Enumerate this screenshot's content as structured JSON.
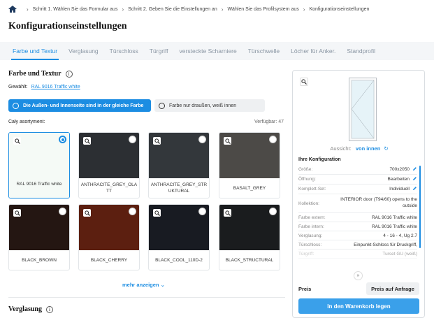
{
  "breadcrumb": {
    "items": [
      "Schritt 1. Wählen Sie das Formular aus",
      "Schritt 2. Geben Sie die Einstellungen an",
      "Wählen Sie das Profilsystem aus",
      "Konfigurationseinstellungen"
    ]
  },
  "page_title": "Konfigurationseinstellungen",
  "tabs": [
    {
      "label": "Farbe und Textur",
      "active": true
    },
    {
      "label": "Verglasung"
    },
    {
      "label": "Türschloss"
    },
    {
      "label": "Türgriff"
    },
    {
      "label": "versteckte Scharniere"
    },
    {
      "label": "Türschwelle"
    },
    {
      "label": "Löcher für Anker."
    },
    {
      "label": "Standprofil"
    }
  ],
  "color_section": {
    "title": "Farbe und Textur",
    "info": "i",
    "selected_label": "Gewählt:",
    "selected_value": "RAL 9016 Traffic white",
    "option_same": "Die Außen- und Innenseite sind in der gleiche Farbe",
    "option_outside": "Farbe nur draußen, weiß innen",
    "assortment_label": "Cały asortyment:",
    "available_label": "Verfügbar: 47"
  },
  "swatches": [
    {
      "name": "RAL 9016 Traffic white",
      "color": "#f5faf6",
      "selected": true
    },
    {
      "name": "ANTHRACITE_GREY_OLATT",
      "color": "#2c2f33"
    },
    {
      "name": "ANTHRACITE_GREY_STRUKTURAL",
      "color": "#33373b"
    },
    {
      "name": "BASALT_GREY",
      "color": "#4c4a47"
    },
    {
      "name": "BLACK_BROWN",
      "color": "#241612"
    },
    {
      "name": "BLACK_CHERRY",
      "color": "#5c1f10"
    },
    {
      "name": "BLACK_COOL_110D-2",
      "color": "#181b22"
    },
    {
      "name": "BLACK_STRUCTURAL",
      "color": "#1a1c1e"
    }
  ],
  "more_label": "mehr anzeigen",
  "glazing_section": {
    "title": "Verglasung",
    "info": "i"
  },
  "panel": {
    "view_label": "Aussicht:",
    "view_value": "von innen",
    "config_title": "Ihre Konfiguration",
    "rows": [
      {
        "key": "Größe:",
        "value": "700x2050",
        "edit": true
      },
      {
        "key": "Öffnung:",
        "value": "Bearbeiten",
        "edit": true
      },
      {
        "key": "Komplett-Set:",
        "value": "Individuell",
        "edit": true
      },
      {
        "key": "Kollektion:",
        "value": "INTERIOR door (T94/60) opens to the outside"
      },
      {
        "key": "Farbe extern:",
        "value": "RAL 9016 Traffic white"
      },
      {
        "key": "Farbe intern:",
        "value": "RAL 9016 Traffic white"
      },
      {
        "key": "Verglasung:",
        "value": "4 - 16 - 4, Ug 2.7"
      },
      {
        "key": "Türschloss:",
        "value": "Einpunkt-Schloss für Druckgriff,"
      },
      {
        "key": "Türgriff:",
        "value": "Turset GU (weiß)"
      }
    ],
    "price_label": "Preis",
    "price_button": "Preis auf Anfrage",
    "cart_button": "In den Warenkorb legen"
  },
  "colors": {
    "accent": "#1c8de2",
    "cart": "#3aa0ea"
  }
}
